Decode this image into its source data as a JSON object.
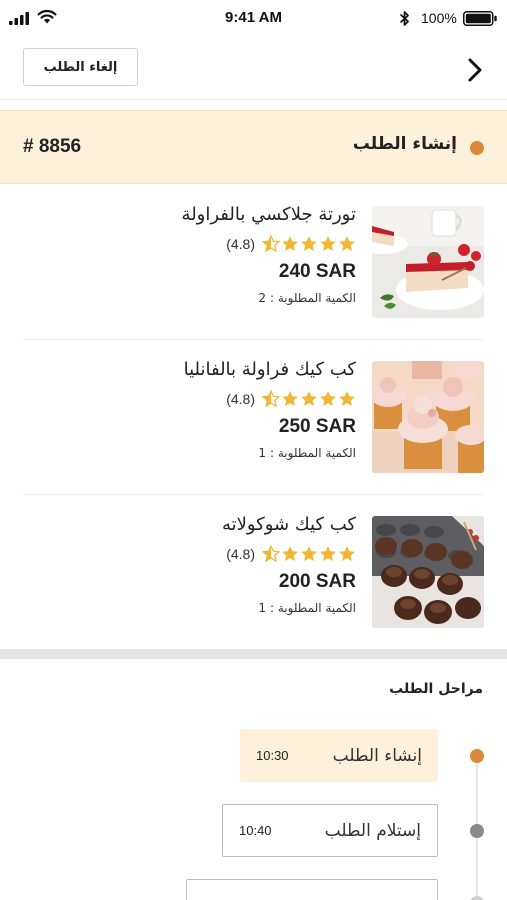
{
  "status_bar": {
    "time": "9:41 AM",
    "battery": "100%"
  },
  "header": {
    "cancel_label": "إلغاء الطلب"
  },
  "order": {
    "number": "# 8856",
    "status": "إنشاء الطلب",
    "status_color": "#d8893a"
  },
  "items": [
    {
      "name": "تورتة جلاكسي بالفراولة",
      "rating": "(4.8)",
      "stars": 4.5,
      "price": "240 SAR",
      "qty_label": "الكمية المطلوبة :",
      "qty": "2"
    },
    {
      "name": "كب كيك فراولة بالفانليا",
      "rating": "(4.8)",
      "stars": 4.5,
      "price": "250 SAR",
      "qty_label": "الكمية المطلوبة :",
      "qty": "1"
    },
    {
      "name": "كب كيك شوكولاته",
      "rating": "(4.8)",
      "stars": 4.5,
      "price": "200 SAR",
      "qty_label": "الكمية المطلوبة :",
      "qty": "1"
    }
  ],
  "stages": {
    "title": "مراحل الطلب",
    "steps": [
      {
        "label": "إنشاء الطلب",
        "time": "10:30",
        "dot_color": "#d8893a"
      },
      {
        "label": "إستلام الطلب",
        "time": "10:40",
        "dot_color": "#8a8a8a"
      },
      {
        "label": "",
        "time": "",
        "dot_color": "#cfcfcf"
      }
    ]
  },
  "colors": {
    "accent": "#d8893a",
    "banner_bg": "#fdf1dc",
    "star": "#f2b632"
  }
}
